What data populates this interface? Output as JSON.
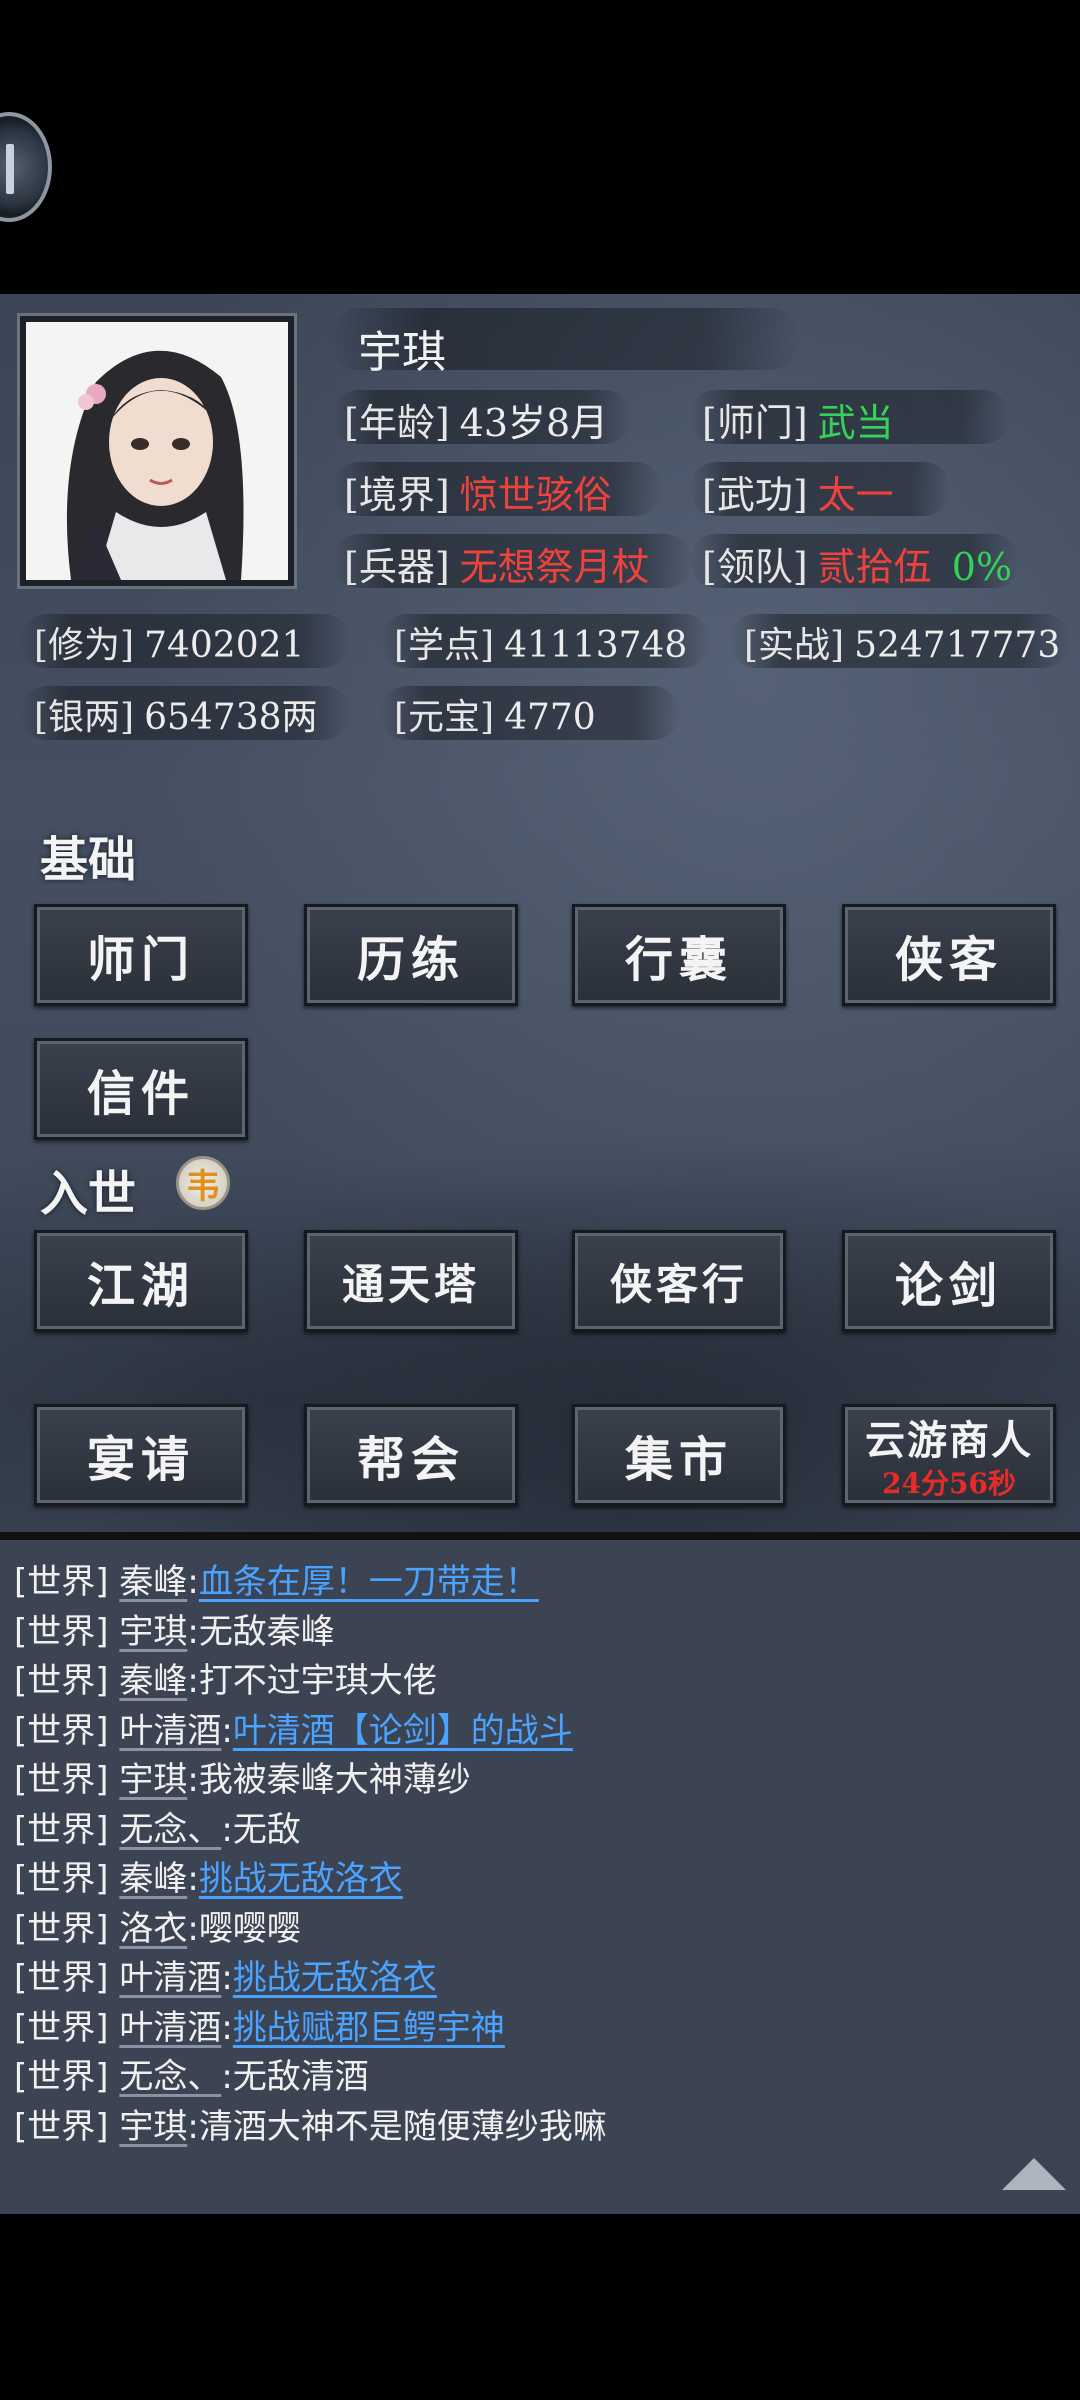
{
  "profile": {
    "name": "宇琪",
    "age_label": "[年龄]",
    "age_value": "43岁8月",
    "sect_label": "[师门]",
    "sect_value": "武当",
    "realm_label": "[境界]",
    "realm_value": "惊世骇俗",
    "skill_label": "[武功]",
    "skill_value": "太一",
    "weapon_label": "[兵器]",
    "weapon_value": "无想祭月杖",
    "team_label": "[领队]",
    "team_value": "贰拾伍",
    "team_pct": "0%",
    "cultivation_label": "[修为]",
    "cultivation_value": "7402021",
    "points_label": "[学点]",
    "points_value": "41113748",
    "combat_label": "[实战]",
    "combat_value": "524717773",
    "silver_label": "[银两]",
    "silver_value": "654738两",
    "ingot_label": "[元宝]",
    "ingot_value": "4770"
  },
  "basic": {
    "title": "基础",
    "buttons": [
      "师门",
      "历练",
      "行囊",
      "侠客",
      "信件"
    ]
  },
  "world": {
    "title": "入世",
    "badge": "韦",
    "buttons": [
      "江湖",
      "通天塔",
      "侠客行",
      "论剑",
      "宴请",
      "帮会",
      "集市"
    ],
    "merchant": {
      "label": "云游商人",
      "timer": "24分56秒"
    }
  },
  "chat": {
    "messages": [
      {
        "channel": "[世界]",
        "name": "秦峰",
        "sep": ":",
        "text": "血条在厚！一刀带走！",
        "link": true
      },
      {
        "channel": "[世界]",
        "name": "宇琪",
        "sep": ":",
        "text": "无敌秦峰",
        "link": false
      },
      {
        "channel": "[世界]",
        "name": "秦峰",
        "sep": ":",
        "text": "打不过宇琪大佬",
        "link": false
      },
      {
        "channel": "[世界]",
        "name": "叶清酒",
        "sep": ":",
        "text": "叶清酒【论剑】的战斗",
        "link": true
      },
      {
        "channel": "[世界]",
        "name": "宇琪",
        "sep": ":",
        "text": "我被秦峰大神薄纱",
        "link": false
      },
      {
        "channel": "[世界]",
        "name": "无念、",
        "sep": ":",
        "text": "无敌",
        "link": false
      },
      {
        "channel": "[世界]",
        "name": "秦峰",
        "sep": ":",
        "text": "挑战无敌洛衣",
        "link": true
      },
      {
        "channel": "[世界]",
        "name": "洛衣",
        "sep": ":",
        "text": "嘤嘤嘤",
        "link": false
      },
      {
        "channel": "[世界]",
        "name": "叶清酒",
        "sep": ":",
        "text": "挑战无敌洛衣",
        "link": true
      },
      {
        "channel": "[世界]",
        "name": "叶清酒",
        "sep": ":",
        "text": "挑战赋郡巨鳄宇神",
        "link": true
      },
      {
        "channel": "[世界]",
        "name": "无念、",
        "sep": ":",
        "text": "无敌清酒",
        "link": false
      },
      {
        "channel": "[世界]",
        "name": "宇琪",
        "sep": ":",
        "text": "清酒大神不是随便薄纱我嘛",
        "link": false
      }
    ]
  },
  "colors": {
    "red": "#f0423c",
    "green": "#33d35a",
    "link": "#4aa3ff"
  }
}
